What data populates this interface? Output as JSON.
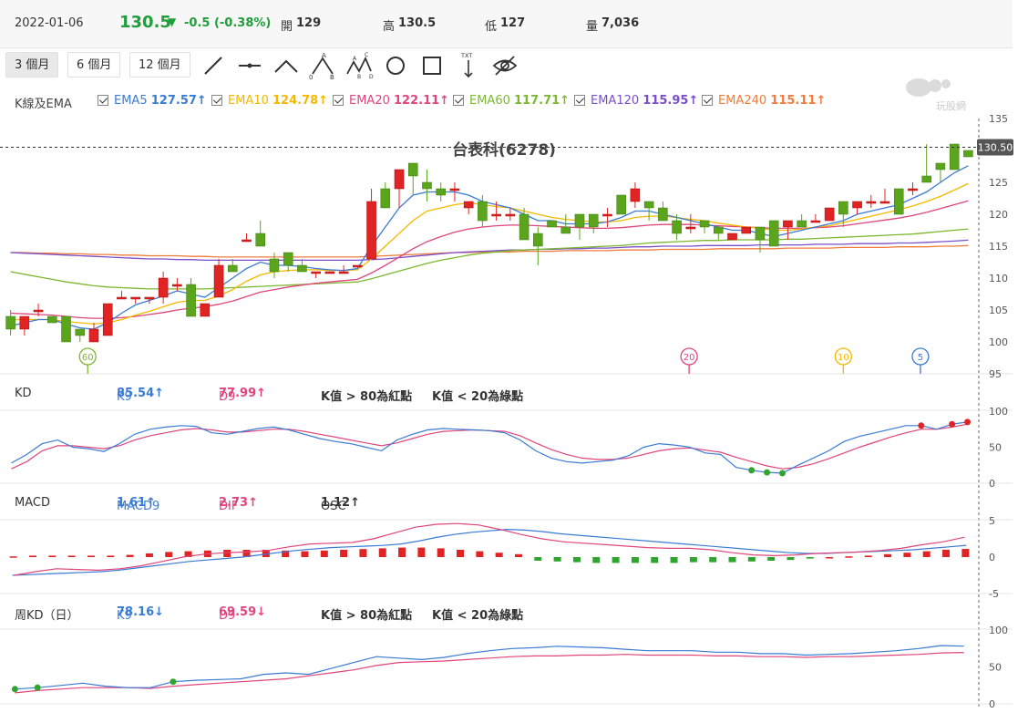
{
  "header": {
    "date": "2022-01-06",
    "price": "130.5",
    "arrow": "▼",
    "change": "-0.5 (-0.38%)",
    "open_label": "開",
    "open": "129",
    "high_label": "高",
    "high": "130.5",
    "low_label": "低",
    "low": "127",
    "vol_label": "量",
    "vol": "7,036"
  },
  "toolbar": {
    "periods": [
      "3 個月",
      "6 個月",
      "12 個月"
    ],
    "active_period": 0,
    "tools": [
      "line-tool-icon",
      "horizontal-line-icon",
      "angle-line-icon",
      "abc-pattern-icon",
      "abcd-pattern-icon",
      "circle-tool-icon",
      "rectangle-tool-icon",
      "text-arrow-icon",
      "hide-eye-icon"
    ],
    "watermark": "玩股網"
  },
  "ema_legend": {
    "title": "K線及EMA",
    "items": [
      {
        "label": "EMA5",
        "value": "127.57↑",
        "color": "#3a7bd5"
      },
      {
        "label": "EMA10",
        "value": "124.78↑",
        "color": "#f5b800"
      },
      {
        "label": "EMA20",
        "value": "122.11↑",
        "color": "#e0457b"
      },
      {
        "label": "EMA60",
        "value": "117.71↑",
        "color": "#7cb82f"
      },
      {
        "label": "EMA120",
        "value": "115.95↑",
        "color": "#7a4fc9"
      },
      {
        "label": "EMA240",
        "value": "115.11↑",
        "color": "#f07c3c"
      }
    ]
  },
  "kd": {
    "title": "KD",
    "k_label": "K9",
    "k_value": "85.54↑",
    "d_label": "D9",
    "d_value": "77.99↑",
    "note1": "K值 > 80為紅點",
    "note2": "K值 < 20為綠點"
  },
  "macd": {
    "title": "MACD",
    "m_label": "MACD9",
    "m_value": "1.61↑",
    "dif_label": "DIF",
    "dif_value": "2.73↑",
    "osc_label": "OSC",
    "osc_value": "1.12↑"
  },
  "wkd": {
    "title": "周KD（日）",
    "k_label": "K9",
    "k_value": "78.16↓",
    "d_label": "D9",
    "d_value": "69.59↓",
    "note1": "K值 > 80為紅點",
    "note2": "K值 < 20為綠點"
  },
  "chart_data": {
    "type": "candlestick",
    "title": "台表科(6278)",
    "current_price": "130.50",
    "ylim": [
      95,
      135
    ],
    "yticks": [
      "95",
      "100",
      "105",
      "110",
      "115",
      "120",
      "125",
      "130",
      "135"
    ],
    "ohlc": [
      [
        104,
        105,
        101,
        102
      ],
      [
        102,
        104,
        101,
        104
      ],
      [
        105,
        106,
        104,
        105
      ],
      [
        104,
        104,
        103,
        103
      ],
      [
        104,
        104,
        100,
        100
      ],
      [
        102,
        102,
        100,
        101
      ],
      [
        100,
        103,
        100,
        102
      ],
      [
        101,
        106,
        101,
        106
      ],
      [
        107,
        108,
        107,
        107
      ],
      [
        107,
        107,
        106,
        107
      ],
      [
        107,
        107,
        106,
        107
      ],
      [
        107,
        111,
        106,
        110
      ],
      [
        109,
        110,
        108,
        109
      ],
      [
        109,
        110,
        104,
        104
      ],
      [
        104,
        106,
        104,
        106
      ],
      [
        107,
        113,
        107,
        112
      ],
      [
        112,
        113,
        111,
        111
      ],
      [
        116,
        117,
        116,
        116
      ],
      [
        117,
        119,
        115,
        115
      ],
      [
        113,
        114,
        110,
        111
      ],
      [
        114,
        114,
        111,
        112
      ],
      [
        112,
        113,
        111,
        111
      ],
      [
        111,
        111,
        110,
        111
      ],
      [
        111,
        111,
        111,
        111
      ],
      [
        111,
        112,
        111,
        111
      ],
      [
        112,
        112,
        112,
        112
      ],
      [
        113,
        124,
        113,
        122
      ],
      [
        124,
        125,
        122,
        121
      ],
      [
        124,
        125,
        121,
        127
      ],
      [
        128,
        128,
        123,
        126
      ],
      [
        125,
        127,
        122,
        124
      ],
      [
        124,
        125,
        122,
        123
      ],
      [
        124,
        125,
        122,
        124
      ],
      [
        121,
        122,
        120,
        122
      ],
      [
        122,
        123,
        118,
        119
      ],
      [
        120,
        122,
        119,
        120
      ],
      [
        120,
        121,
        119,
        120
      ],
      [
        120,
        121,
        116,
        116
      ],
      [
        117,
        118,
        112,
        115
      ],
      [
        119,
        119,
        118,
        118
      ],
      [
        118,
        120,
        117,
        117
      ],
      [
        120,
        120,
        116,
        118
      ],
      [
        120,
        120,
        117,
        118
      ],
      [
        120,
        121,
        118,
        120
      ],
      [
        123,
        123,
        121,
        120
      ],
      [
        122,
        125,
        121,
        124
      ],
      [
        122,
        122,
        119,
        121
      ],
      [
        121,
        122,
        119,
        119
      ],
      [
        119,
        120,
        116,
        117
      ],
      [
        118,
        120,
        117,
        118
      ],
      [
        119,
        119,
        117,
        118
      ],
      [
        118,
        118,
        116,
        117
      ],
      [
        116,
        117,
        116,
        117
      ],
      [
        117,
        117,
        117,
        118
      ],
      [
        118,
        118,
        114,
        116
      ],
      [
        119,
        119,
        115,
        115
      ],
      [
        118,
        118,
        116,
        119
      ],
      [
        119,
        120,
        118,
        118
      ],
      [
        119,
        120,
        119,
        119
      ],
      [
        119,
        121,
        119,
        121
      ],
      [
        122,
        122,
        118,
        120
      ],
      [
        121,
        122,
        120,
        122
      ],
      [
        122,
        123,
        121,
        122
      ],
      [
        122,
        124,
        122,
        122
      ],
      [
        124,
        124,
        121,
        120
      ],
      [
        124,
        125,
        123,
        124
      ],
      [
        126,
        131,
        126,
        125
      ],
      [
        128,
        128,
        125,
        127
      ],
      [
        131,
        131,
        128,
        127
      ],
      [
        130,
        130,
        130,
        129
      ]
    ],
    "ema5": [
      102.5,
      103,
      103.5,
      103.5,
      102.8,
      102.2,
      102,
      103,
      104.5,
      105.8,
      106.5,
      107.2,
      108,
      107.5,
      107,
      108.5,
      110,
      111.5,
      112.5,
      112,
      112,
      111.8,
      111.5,
      111.3,
      111.2,
      111.5,
      115,
      118,
      121,
      123,
      123.5,
      123.5,
      123.5,
      123,
      122,
      121.5,
      121,
      120,
      119,
      119,
      118.5,
      118.5,
      118.5,
      118.8,
      119.5,
      120.5,
      120.5,
      120,
      119.5,
      119,
      118.5,
      118,
      117.5,
      117.5,
      117,
      116.5,
      117,
      117.5,
      118,
      118.5,
      119,
      120,
      120.5,
      121,
      121.5,
      122.5,
      123.5,
      125,
      126.5,
      127.6
    ],
    "ema10": [
      103.5,
      103.5,
      103.5,
      103.5,
      103.2,
      103,
      102.8,
      103,
      103.5,
      104.2,
      104.8,
      105.5,
      106.2,
      106.5,
      106.5,
      107.2,
      108.2,
      109.5,
      110.5,
      111,
      111.2,
      111.3,
      111.3,
      111.2,
      111.2,
      111.3,
      113,
      115,
      117,
      119,
      120.5,
      121,
      121.5,
      121.8,
      121.5,
      121.2,
      121,
      120.5,
      120,
      119.5,
      119.2,
      119,
      118.8,
      118.8,
      119,
      119.5,
      119.7,
      119.7,
      119.5,
      119.2,
      119,
      118.6,
      118.3,
      118,
      117.8,
      117.5,
      117.5,
      117.7,
      118,
      118.2,
      118.7,
      119.2,
      119.7,
      120.2,
      120.7,
      121.3,
      122,
      122.8,
      123.8,
      124.8
    ],
    "ema20": [
      104.5,
      104.4,
      104.3,
      104.2,
      104,
      103.8,
      103.7,
      103.7,
      103.8,
      104,
      104.3,
      104.6,
      105,
      105.3,
      105.5,
      105.9,
      106.4,
      107.1,
      107.8,
      108.2,
      108.6,
      108.9,
      109.2,
      109.4,
      109.6,
      109.8,
      110.8,
      112,
      113.3,
      114.6,
      115.7,
      116.5,
      117.2,
      117.7,
      118,
      118.2,
      118.3,
      118.3,
      118.2,
      118.1,
      118,
      117.9,
      117.8,
      117.8,
      117.9,
      118.1,
      118.3,
      118.4,
      118.4,
      118.4,
      118.3,
      118.2,
      118.1,
      118,
      117.9,
      117.8,
      117.8,
      117.8,
      117.9,
      118,
      118.2,
      118.5,
      118.8,
      119.1,
      119.4,
      119.8,
      120.3,
      120.9,
      121.5,
      122.1
    ],
    "ema60": [
      111,
      110.6,
      110.2,
      109.8,
      109.4,
      109.1,
      108.8,
      108.6,
      108.5,
      108.4,
      108.3,
      108.3,
      108.3,
      108.3,
      108.3,
      108.4,
      108.5,
      108.6,
      108.7,
      108.8,
      108.9,
      109,
      109.1,
      109.2,
      109.3,
      109.4,
      109.9,
      110.5,
      111.1,
      111.7,
      112.3,
      112.8,
      113.2,
      113.6,
      113.9,
      114.1,
      114.3,
      114.4,
      114.5,
      114.6,
      114.7,
      114.8,
      114.9,
      115,
      115.1,
      115.3,
      115.5,
      115.6,
      115.7,
      115.8,
      115.9,
      115.9,
      116,
      116,
      116,
      116,
      116.1,
      116.1,
      116.2,
      116.3,
      116.4,
      116.5,
      116.6,
      116.7,
      116.8,
      116.9,
      117.1,
      117.3,
      117.5,
      117.7
    ],
    "ema120": [
      114,
      113.9,
      113.8,
      113.7,
      113.6,
      113.5,
      113.4,
      113.3,
      113.2,
      113.1,
      113,
      113,
      112.9,
      112.9,
      112.8,
      112.8,
      112.8,
      112.8,
      112.8,
      112.8,
      112.8,
      112.8,
      112.8,
      112.8,
      112.8,
      112.8,
      112.9,
      113,
      113.2,
      113.4,
      113.6,
      113.8,
      114,
      114.1,
      114.2,
      114.3,
      114.4,
      114.4,
      114.5,
      114.5,
      114.6,
      114.6,
      114.7,
      114.7,
      114.8,
      114.9,
      114.9,
      115,
      115,
      115,
      115.1,
      115.1,
      115.1,
      115.1,
      115.2,
      115.2,
      115.2,
      115.2,
      115.3,
      115.3,
      115.3,
      115.4,
      115.4,
      115.4,
      115.5,
      115.5,
      115.6,
      115.7,
      115.8,
      115.95
    ],
    "ema240": [
      114,
      114,
      113.9,
      113.9,
      113.8,
      113.8,
      113.7,
      113.7,
      113.6,
      113.6,
      113.5,
      113.5,
      113.5,
      113.4,
      113.4,
      113.3,
      113.3,
      113.3,
      113.3,
      113.3,
      113.3,
      113.3,
      113.3,
      113.3,
      113.3,
      113.3,
      113.4,
      113.5,
      113.6,
      113.7,
      113.8,
      113.9,
      114,
      114,
      114.1,
      114.1,
      114.1,
      114.2,
      114.2,
      114.2,
      114.3,
      114.3,
      114.3,
      114.3,
      114.4,
      114.4,
      114.4,
      114.5,
      114.5,
      114.5,
      114.5,
      114.6,
      114.6,
      114.6,
      114.6,
      114.6,
      114.7,
      114.7,
      114.7,
      114.7,
      114.8,
      114.8,
      114.8,
      114.8,
      114.9,
      114.9,
      114.9,
      115,
      115,
      115.1
    ],
    "markers": [
      {
        "label": "60",
        "index": 5,
        "color": "#7cb82f"
      },
      {
        "label": "20",
        "index": 44,
        "color": "#e0457b"
      },
      {
        "label": "10",
        "index": 54,
        "color": "#f5b800"
      },
      {
        "label": "5",
        "index": 59,
        "color": "#3a7bd5"
      }
    ],
    "kd": {
      "ylim": [
        0,
        100
      ],
      "yticks": [
        "0",
        "50",
        "100"
      ],
      "k": [
        28,
        40,
        55,
        60,
        50,
        48,
        44,
        55,
        68,
        75,
        78,
        80,
        79,
        70,
        68,
        72,
        76,
        78,
        74,
        68,
        62,
        58,
        55,
        50,
        45,
        60,
        68,
        74,
        76,
        75,
        74,
        73,
        70,
        60,
        45,
        35,
        30,
        28,
        30,
        32,
        38,
        50,
        55,
        53,
        50,
        42,
        40,
        22,
        18,
        15,
        14,
        25,
        35,
        45,
        58,
        65,
        70,
        75,
        80,
        80,
        75,
        82,
        85
      ],
      "d": [
        20,
        30,
        45,
        52,
        52,
        50,
        48,
        52,
        60,
        66,
        70,
        74,
        76,
        74,
        71,
        71,
        73,
        75,
        75,
        72,
        68,
        64,
        60,
        56,
        52,
        56,
        62,
        68,
        72,
        73,
        74,
        73,
        72,
        66,
        56,
        47,
        40,
        35,
        33,
        33,
        35,
        40,
        45,
        48,
        49,
        46,
        43,
        36,
        30,
        24,
        20,
        22,
        27,
        34,
        42,
        50,
        57,
        64,
        70,
        75,
        75,
        78,
        82
      ],
      "red_points": [
        59,
        61,
        62
      ],
      "green_points": [
        48,
        49,
        50
      ]
    },
    "macd": {
      "ylim": [
        -5,
        5
      ],
      "yticks": [
        "-5",
        "0",
        "5"
      ],
      "macd": [
        -2.5,
        -2.4,
        -2.3,
        -2.2,
        -2.1,
        -2,
        -1.8,
        -1.5,
        -1.2,
        -0.9,
        -0.6,
        -0.4,
        -0.2,
        0,
        0.3,
        0.6,
        0.9,
        1.1,
        1.3,
        1.4,
        1.5,
        1.6,
        1.8,
        2.2,
        2.7,
        3.1,
        3.4,
        3.6,
        3.8,
        3.7,
        3.5,
        3.2,
        3,
        2.8,
        2.6,
        2.4,
        2.2,
        2,
        1.8,
        1.6,
        1.4,
        1.2,
        1,
        0.8,
        0.6,
        0.5,
        0.5,
        0.6,
        0.7,
        0.8,
        0.9,
        1,
        1.2,
        1.4,
        1.61
      ],
      "dif": [
        -2.5,
        -2,
        -1.6,
        -1.7,
        -1.8,
        -1.6,
        -1.2,
        -0.6,
        0,
        0.4,
        0.6,
        0.7,
        0.9,
        1.4,
        1.8,
        1.9,
        2,
        2.5,
        3.3,
        4.1,
        4.5,
        4.6,
        4.4,
        3.8,
        3.1,
        2.5,
        2.1,
        1.9,
        1.7,
        1.5,
        1.3,
        1.2,
        1.2,
        1,
        0.6,
        0.3,
        0.2,
        0.3,
        0.5,
        0.6,
        0.7,
        0.9,
        1.2,
        1.7,
        2.1,
        2.73
      ],
      "osc": [
        0.1,
        0.2,
        0.2,
        0.2,
        0.2,
        0.2,
        0.3,
        0.5,
        0.7,
        0.8,
        0.9,
        1,
        1,
        1,
        0.9,
        0.8,
        0.9,
        1,
        1.1,
        1.2,
        1.3,
        1.3,
        1.2,
        1,
        0.8,
        0.6,
        0.4,
        -0.5,
        -0.6,
        -0.7,
        -0.8,
        -0.8,
        -0.8,
        -0.8,
        -0.8,
        -0.7,
        -0.7,
        -0.7,
        -0.6,
        -0.5,
        -0.4,
        -0.2,
        0,
        0.1,
        0.2,
        0.4,
        0.6,
        0.8,
        1,
        1.12
      ]
    },
    "wkd": {
      "ylim": [
        0,
        100
      ],
      "yticks": [
        "0",
        "50",
        "100"
      ],
      "k": [
        20,
        22,
        25,
        28,
        24,
        22,
        22,
        30,
        32,
        33,
        34,
        40,
        42,
        40,
        48,
        56,
        64,
        62,
        60,
        63,
        68,
        72,
        75,
        76,
        78,
        77,
        76,
        74,
        72,
        72,
        72,
        70,
        70,
        68,
        68,
        66,
        67,
        68,
        70,
        72,
        75,
        79,
        78.16
      ],
      "d": [
        15,
        18,
        20,
        22,
        22,
        22,
        21,
        24,
        26,
        28,
        30,
        32,
        34,
        38,
        42,
        46,
        52,
        56,
        57,
        58,
        60,
        62,
        64,
        65,
        65,
        66,
        66,
        67,
        66,
        66,
        66,
        65,
        65,
        64,
        64,
        63,
        64,
        64,
        65,
        66,
        67,
        69,
        69.59
      ],
      "green_points": [
        0,
        1,
        7
      ]
    }
  }
}
